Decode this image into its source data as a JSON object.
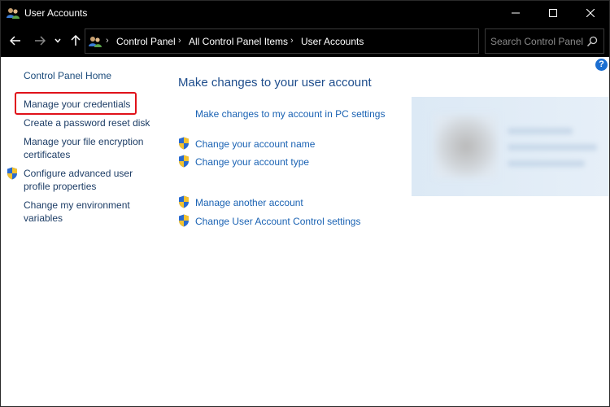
{
  "window": {
    "title": "User Accounts"
  },
  "address_bar": {
    "breadcrumbs": [
      "Control Panel",
      "All Control Panel Items",
      "User Accounts"
    ],
    "search_placeholder": "Search Control Panel"
  },
  "sidebar": {
    "items": [
      {
        "label": "Control Panel Home",
        "highlighted": false,
        "shield": false
      },
      {
        "label": "Manage your credentials",
        "highlighted": true,
        "shield": false
      },
      {
        "label": "Create a password reset disk",
        "highlighted": false,
        "shield": false
      },
      {
        "label": "Manage your file encryption certificates",
        "lines": [
          "Manage your file encryption",
          "certificates"
        ],
        "highlighted": false,
        "shield": false
      },
      {
        "label": "Configure advanced user profile properties",
        "lines": [
          "Configure advanced user",
          "profile properties"
        ],
        "highlighted": false,
        "shield": true
      },
      {
        "label": "Change my environment variables",
        "lines": [
          "Change my environment",
          "variables"
        ],
        "highlighted": false,
        "shield": false
      }
    ]
  },
  "main": {
    "heading": "Make changes to your user account",
    "links": [
      {
        "label": "Make changes to my account in PC settings",
        "shield": false
      },
      {
        "label": "Change your account name",
        "shield": true
      },
      {
        "label": "Change your account type",
        "shield": true
      },
      {
        "label": "Manage another account",
        "shield": true
      },
      {
        "label": "Change User Account Control settings",
        "shield": true
      }
    ]
  },
  "icons": {
    "title": "user-accounts-icon",
    "back": "arrow-left-icon",
    "forward": "arrow-right-icon",
    "recent": "chevron-down-icon",
    "up": "arrow-up-icon",
    "dropdown": "chevron-down-icon",
    "refresh": "refresh-icon",
    "search": "search-icon",
    "help": "help-icon",
    "shield": "uac-shield-icon"
  },
  "colors": {
    "link": "#1a62b3",
    "heading": "#1e4d8c",
    "highlight": "#e0121a",
    "titlebar": "#000000"
  }
}
